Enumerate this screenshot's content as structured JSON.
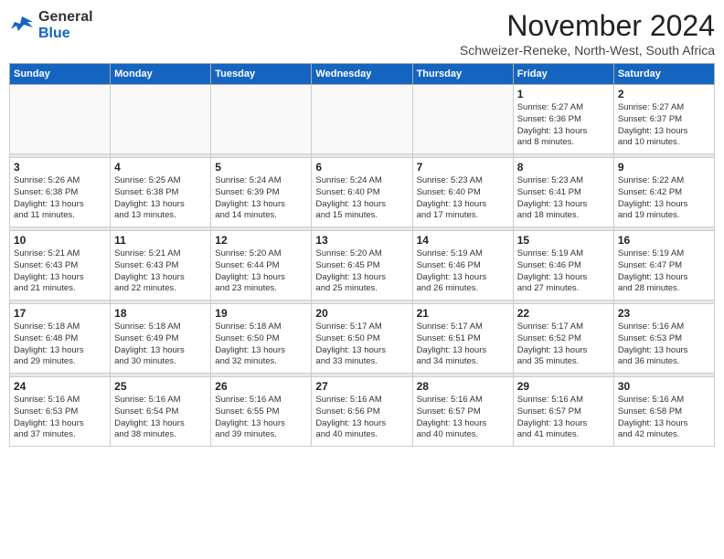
{
  "header": {
    "logo_general": "General",
    "logo_blue": "Blue",
    "month_title": "November 2024",
    "subtitle": "Schweizer-Reneke, North-West, South Africa"
  },
  "weekdays": [
    "Sunday",
    "Monday",
    "Tuesday",
    "Wednesday",
    "Thursday",
    "Friday",
    "Saturday"
  ],
  "weeks": [
    [
      {
        "day": "",
        "info": ""
      },
      {
        "day": "",
        "info": ""
      },
      {
        "day": "",
        "info": ""
      },
      {
        "day": "",
        "info": ""
      },
      {
        "day": "",
        "info": ""
      },
      {
        "day": "1",
        "info": "Sunrise: 5:27 AM\nSunset: 6:36 PM\nDaylight: 13 hours\nand 8 minutes."
      },
      {
        "day": "2",
        "info": "Sunrise: 5:27 AM\nSunset: 6:37 PM\nDaylight: 13 hours\nand 10 minutes."
      }
    ],
    [
      {
        "day": "3",
        "info": "Sunrise: 5:26 AM\nSunset: 6:38 PM\nDaylight: 13 hours\nand 11 minutes."
      },
      {
        "day": "4",
        "info": "Sunrise: 5:25 AM\nSunset: 6:38 PM\nDaylight: 13 hours\nand 13 minutes."
      },
      {
        "day": "5",
        "info": "Sunrise: 5:24 AM\nSunset: 6:39 PM\nDaylight: 13 hours\nand 14 minutes."
      },
      {
        "day": "6",
        "info": "Sunrise: 5:24 AM\nSunset: 6:40 PM\nDaylight: 13 hours\nand 15 minutes."
      },
      {
        "day": "7",
        "info": "Sunrise: 5:23 AM\nSunset: 6:40 PM\nDaylight: 13 hours\nand 17 minutes."
      },
      {
        "day": "8",
        "info": "Sunrise: 5:23 AM\nSunset: 6:41 PM\nDaylight: 13 hours\nand 18 minutes."
      },
      {
        "day": "9",
        "info": "Sunrise: 5:22 AM\nSunset: 6:42 PM\nDaylight: 13 hours\nand 19 minutes."
      }
    ],
    [
      {
        "day": "10",
        "info": "Sunrise: 5:21 AM\nSunset: 6:43 PM\nDaylight: 13 hours\nand 21 minutes."
      },
      {
        "day": "11",
        "info": "Sunrise: 5:21 AM\nSunset: 6:43 PM\nDaylight: 13 hours\nand 22 minutes."
      },
      {
        "day": "12",
        "info": "Sunrise: 5:20 AM\nSunset: 6:44 PM\nDaylight: 13 hours\nand 23 minutes."
      },
      {
        "day": "13",
        "info": "Sunrise: 5:20 AM\nSunset: 6:45 PM\nDaylight: 13 hours\nand 25 minutes."
      },
      {
        "day": "14",
        "info": "Sunrise: 5:19 AM\nSunset: 6:46 PM\nDaylight: 13 hours\nand 26 minutes."
      },
      {
        "day": "15",
        "info": "Sunrise: 5:19 AM\nSunset: 6:46 PM\nDaylight: 13 hours\nand 27 minutes."
      },
      {
        "day": "16",
        "info": "Sunrise: 5:19 AM\nSunset: 6:47 PM\nDaylight: 13 hours\nand 28 minutes."
      }
    ],
    [
      {
        "day": "17",
        "info": "Sunrise: 5:18 AM\nSunset: 6:48 PM\nDaylight: 13 hours\nand 29 minutes."
      },
      {
        "day": "18",
        "info": "Sunrise: 5:18 AM\nSunset: 6:49 PM\nDaylight: 13 hours\nand 30 minutes."
      },
      {
        "day": "19",
        "info": "Sunrise: 5:18 AM\nSunset: 6:50 PM\nDaylight: 13 hours\nand 32 minutes."
      },
      {
        "day": "20",
        "info": "Sunrise: 5:17 AM\nSunset: 6:50 PM\nDaylight: 13 hours\nand 33 minutes."
      },
      {
        "day": "21",
        "info": "Sunrise: 5:17 AM\nSunset: 6:51 PM\nDaylight: 13 hours\nand 34 minutes."
      },
      {
        "day": "22",
        "info": "Sunrise: 5:17 AM\nSunset: 6:52 PM\nDaylight: 13 hours\nand 35 minutes."
      },
      {
        "day": "23",
        "info": "Sunrise: 5:16 AM\nSunset: 6:53 PM\nDaylight: 13 hours\nand 36 minutes."
      }
    ],
    [
      {
        "day": "24",
        "info": "Sunrise: 5:16 AM\nSunset: 6:53 PM\nDaylight: 13 hours\nand 37 minutes."
      },
      {
        "day": "25",
        "info": "Sunrise: 5:16 AM\nSunset: 6:54 PM\nDaylight: 13 hours\nand 38 minutes."
      },
      {
        "day": "26",
        "info": "Sunrise: 5:16 AM\nSunset: 6:55 PM\nDaylight: 13 hours\nand 39 minutes."
      },
      {
        "day": "27",
        "info": "Sunrise: 5:16 AM\nSunset: 6:56 PM\nDaylight: 13 hours\nand 40 minutes."
      },
      {
        "day": "28",
        "info": "Sunrise: 5:16 AM\nSunset: 6:57 PM\nDaylight: 13 hours\nand 40 minutes."
      },
      {
        "day": "29",
        "info": "Sunrise: 5:16 AM\nSunset: 6:57 PM\nDaylight: 13 hours\nand 41 minutes."
      },
      {
        "day": "30",
        "info": "Sunrise: 5:16 AM\nSunset: 6:58 PM\nDaylight: 13 hours\nand 42 minutes."
      }
    ]
  ]
}
